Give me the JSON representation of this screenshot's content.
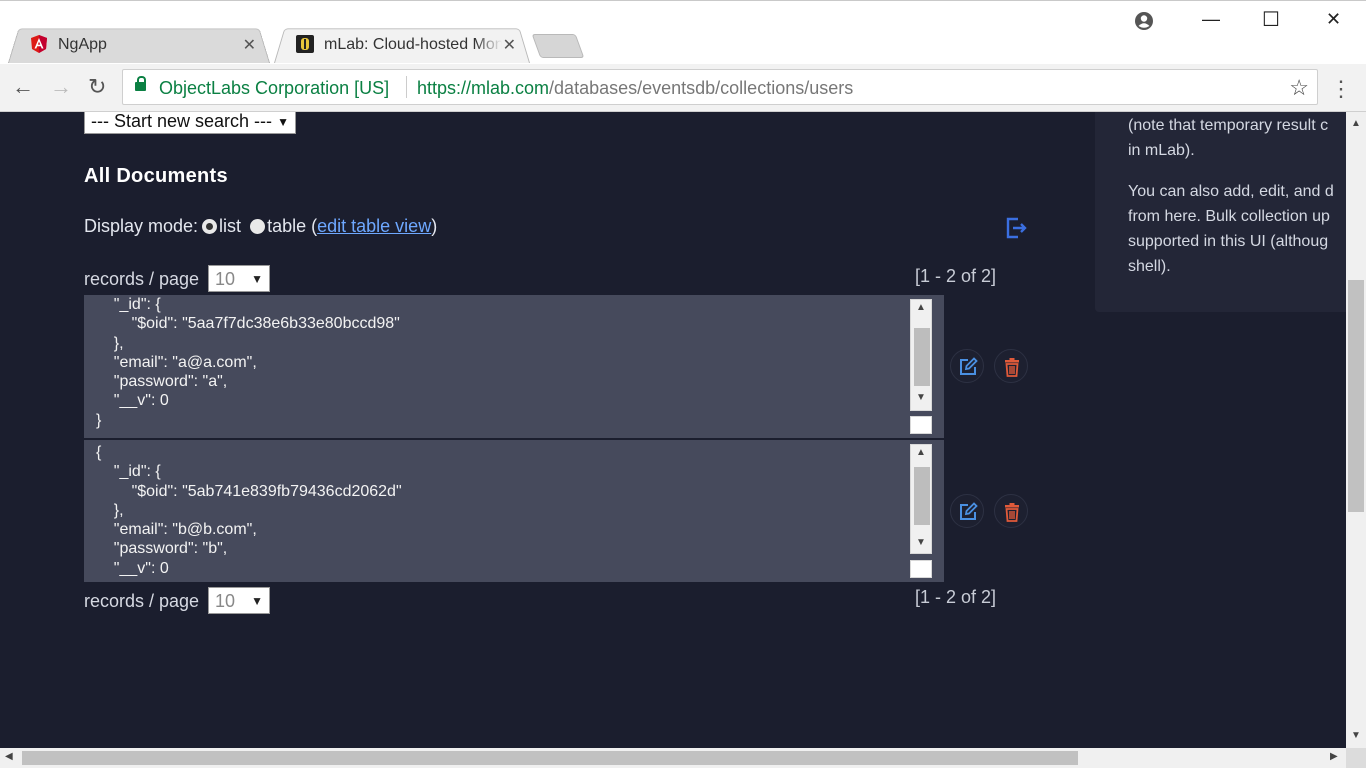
{
  "browser": {
    "tabs": [
      {
        "title": "NgApp",
        "active": false
      },
      {
        "title": "mLab: Cloud-hosted MongoDB",
        "active": true
      }
    ],
    "close_glyph": "✕",
    "window_controls": {
      "minimize": "—",
      "maximize": "☐",
      "close": "✕"
    },
    "nav": {
      "back": "←",
      "forward": "→",
      "reload": "↻"
    },
    "omnibox": {
      "org": "ObjectLabs Corporation [US]",
      "url_scheme_host": "https://mlab.com",
      "url_path": "/databases/eventsdb/collections/users"
    },
    "bookmark_glyph": "☆",
    "menu_glyph": "⋮"
  },
  "page": {
    "search_select": "--- Start new search ---",
    "heading": "All Documents",
    "display_mode": {
      "label": "Display mode:",
      "list_label": "list",
      "table_label": "table",
      "paren_open": "(",
      "edit_link": "edit table view",
      "paren_close": ")",
      "selected": "list"
    },
    "records_label": "records / page",
    "records_per_page": "10",
    "range_text": "[1 - 2 of 2]",
    "documents": [
      {
        "text": "    \"_id\": {\n        \"$oid\": \"5aa7f7dc38e6b33e80bccd98\"\n    },\n    \"email\": \"a@a.com\",\n    \"password\": \"a\",\n    \"__v\": 0\n}"
      },
      {
        "text": "{\n    \"_id\": {\n        \"$oid\": \"5ab741e839fb79436cd2062d\"\n    },\n    \"email\": \"b@b.com\",\n    \"password\": \"b\",\n    \"__v\": 0"
      }
    ],
    "info_panel": {
      "line1": "(note that temporary result c",
      "line2": "in mLab).",
      "line3": "You can also add, edit, and d",
      "line4": "from here. Bulk collection up",
      "line5": "supported in this UI (althoug",
      "line6": "shell)."
    }
  },
  "colors": {
    "page_bg": "#1b1e2e",
    "doc_bg": "#464a5c",
    "link": "#6ea8ff",
    "edit_icon": "#4a90e2",
    "delete_icon": "#e05a3a",
    "secure_green": "#0b8043"
  },
  "icons": [
    "angular-icon",
    "mlab-icon",
    "account-icon",
    "lock-icon",
    "star-icon",
    "menu-icon",
    "export-icon",
    "edit-icon",
    "delete-icon"
  ]
}
